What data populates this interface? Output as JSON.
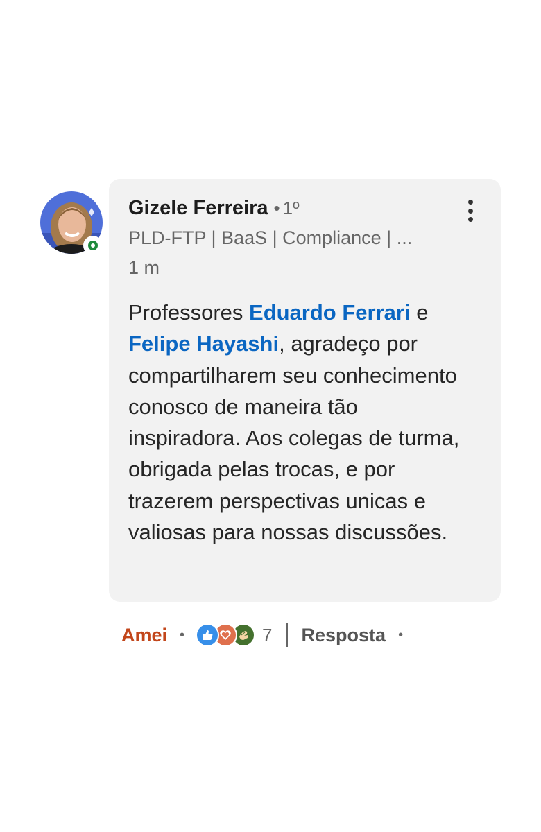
{
  "comment": {
    "author": {
      "name": "Gizele Ferreira",
      "separator": "•",
      "degree": "1º",
      "headline": "PLD-FTP | BaaS | Compliance | ...",
      "time": "1 m",
      "online_color": "#1f8a3b"
    },
    "text": {
      "part1": "Professores ",
      "mention1": "Eduardo Ferrari",
      "part2": " e ",
      "mention2": "Felipe Hayashi",
      "part3": ", agradeço por compartilharem seu conhecimento conosco de maneira tão inspiradora. Aos colegas de turma, obrigada pelas trocas, e por trazerem perspectivas unicas e valiosas para nossas discussões."
    },
    "actions": {
      "reaction_label": "Amei",
      "dot": "•",
      "reaction_icons": [
        "like-icon",
        "love-icon",
        "support-icon"
      ],
      "reaction_count": "7",
      "reply_label": "Resposta",
      "reaction_label_color": "#c2461b"
    }
  }
}
